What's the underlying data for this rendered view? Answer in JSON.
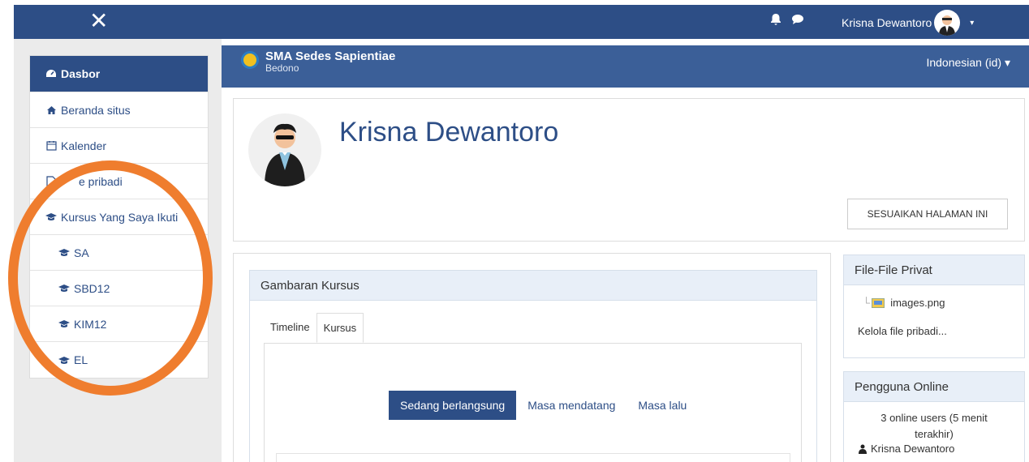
{
  "topbar": {
    "close_label": "✕",
    "user_name": "Krisna Dewantoro",
    "user_menu_caret": "▾"
  },
  "brand": {
    "name": "SMA Sedes Sapientiae",
    "subtitle": "Bedono",
    "language": "Indonesian (id) ▾"
  },
  "sidebar": {
    "items": [
      {
        "label": "Dasbor",
        "icon": "dashboard-icon"
      },
      {
        "label": "Beranda situs",
        "icon": "home-icon"
      },
      {
        "label": "Kalender",
        "icon": "calendar-icon"
      },
      {
        "label": "e pribadi",
        "icon": "file-icon"
      },
      {
        "label": "Kursus Yang Saya Ikuti",
        "icon": "graduation-cap-icon"
      },
      {
        "label": "SA",
        "icon": "graduation-cap-icon"
      },
      {
        "label": "SBD12",
        "icon": "graduation-cap-icon"
      },
      {
        "label": "KIM12",
        "icon": "graduation-cap-icon"
      },
      {
        "label": "EL",
        "icon": "graduation-cap-icon"
      }
    ]
  },
  "header": {
    "title": "Krisna Dewantoro",
    "customize_button": "SESUAIKAN HALAMAN INI"
  },
  "overview": {
    "title": "Gambaran Kursus",
    "tabs": [
      "Timeline",
      "Kursus"
    ],
    "filters": [
      "Sedang berlangsung",
      "Masa mendatang",
      "Masa lalu"
    ]
  },
  "private_files": {
    "title": "File-File Privat",
    "file": "images.png",
    "manage_link": "Kelola file pribadi..."
  },
  "online_users": {
    "title": "Pengguna Online",
    "summary": "3 online users (5 menit terakhir)",
    "user": "Krisna Dewantoro"
  },
  "colors": {
    "navbar": "#2d4e86",
    "brandbar": "#3b5f98",
    "annotation": "#ef7d2e"
  }
}
